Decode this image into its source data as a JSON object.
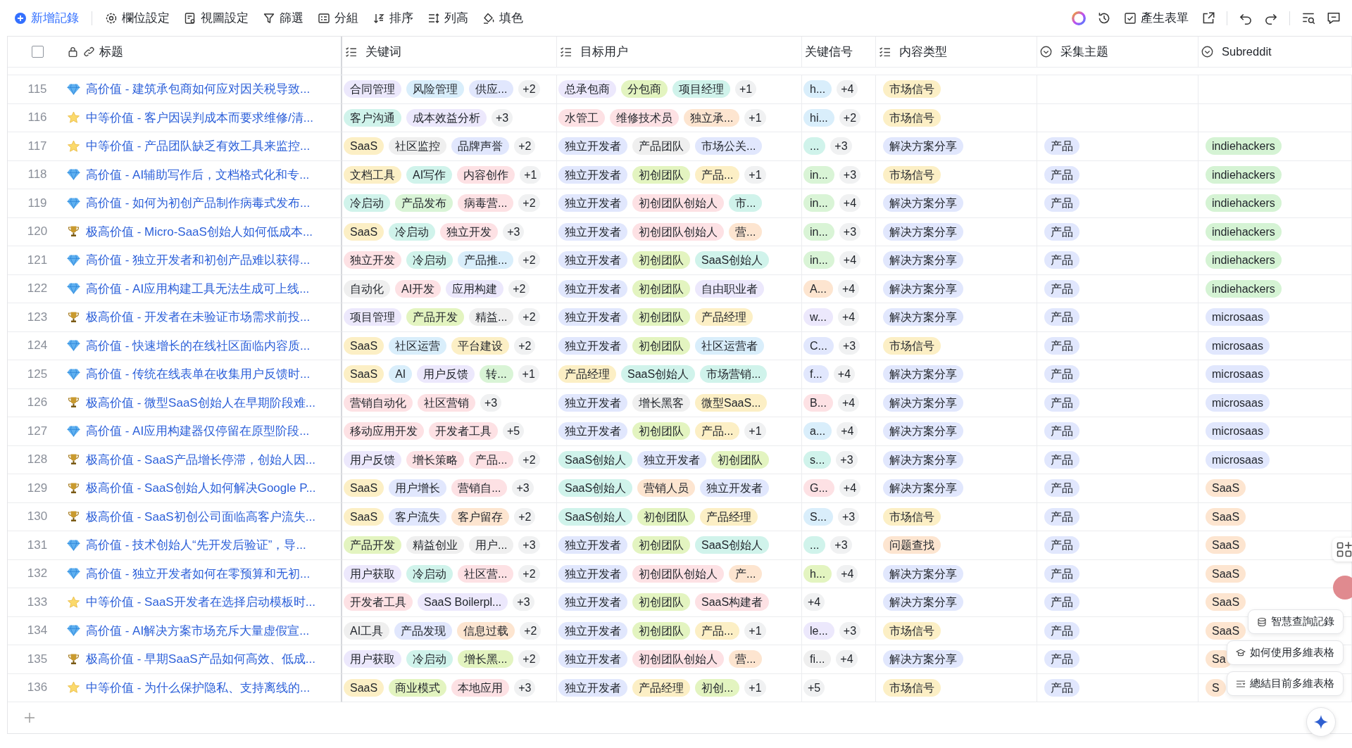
{
  "toolbar": {
    "actions": [
      "新增記錄",
      "欄位設定",
      "視圖設定",
      "篩選",
      "分組",
      "排序",
      "列高",
      "填色"
    ],
    "form_button": "產生表單"
  },
  "select_all": {
    "checked": false
  },
  "columns": [
    {
      "label": "标题"
    },
    {
      "label": "关键词"
    },
    {
      "label": "目标用户"
    },
    {
      "label": "关键信号"
    },
    {
      "label": "内容类型"
    },
    {
      "label": "采集主题"
    },
    {
      "label": "Subreddit"
    }
  ],
  "rows": [
    {
      "num": "115",
      "kind": "diamond",
      "title": "高价值 - 建筑承包商如何应对因关税导致...",
      "keywords": [
        {
          "text": "合同管理",
          "color": "#ece8fc"
        },
        {
          "text": "风险管理",
          "color": "#d9eefb"
        },
        {
          "text": "供应...",
          "color": "#e1e7fd"
        }
      ],
      "keywords_more": "+2",
      "users": [
        {
          "text": "总承包商",
          "color": "#ece8fc"
        },
        {
          "text": "分包商",
          "color": "#e3f4c0"
        },
        {
          "text": "项目经理",
          "color": "#d0f3eb"
        }
      ],
      "users_more": "+1",
      "signals": [
        {
          "text": "h...",
          "color": "#d9eefb"
        }
      ],
      "signals_more": "+4",
      "content_type": {
        "text": "市场信号",
        "color": "#fcefc5"
      }
    },
    {
      "num": "116",
      "kind": "star",
      "title": "中等价值 - 客户因误判成本而要求维修/清...",
      "keywords": [
        {
          "text": "客户沟通",
          "color": "#d0f3eb"
        },
        {
          "text": "成本效益分析",
          "color": "#ece8fc"
        }
      ],
      "keywords_more": "+3",
      "users": [
        {
          "text": "水管工",
          "color": "#fde1e4"
        },
        {
          "text": "维修技术员",
          "color": "#fde1e4"
        },
        {
          "text": "独立承...",
          "color": "#fde5d0"
        }
      ],
      "users_more": "+1",
      "signals": [
        {
          "text": "hi...",
          "color": "#d9eefb"
        }
      ],
      "signals_more": "+2",
      "content_type": {
        "text": "市场信号",
        "color": "#fcefc5"
      }
    },
    {
      "num": "117",
      "kind": "star",
      "title": "中等价值 - 产品团队缺乏有效工具来监控...",
      "keywords": [
        {
          "text": "SaaS",
          "color": "#fcefc5"
        },
        {
          "text": "社区监控",
          "color": "#efefef"
        },
        {
          "text": "品牌声誉",
          "color": "#e1e7fd"
        }
      ],
      "keywords_more": "+2",
      "users": [
        {
          "text": "独立开发者",
          "color": "#e1e7fd"
        },
        {
          "text": "产品团队",
          "color": "#efefef"
        },
        {
          "text": "市场公关...",
          "color": "#e1e7fd"
        }
      ],
      "signals": [
        {
          "text": "...",
          "color": "#d0f3eb"
        }
      ],
      "signals_more": "+3",
      "content_type": {
        "text": "解决方案分享",
        "color": "#e1e7fd"
      },
      "topic": {
        "text": "产品",
        "color": "#e1e7fd"
      },
      "subreddit": {
        "text": "indiehackers",
        "color": "#d5f3d4"
      }
    },
    {
      "num": "118",
      "kind": "diamond",
      "title": "高价值 - AI辅助写作后，文档格式化和专...",
      "keywords": [
        {
          "text": "文档工具",
          "color": "#fcefc5"
        },
        {
          "text": "AI写作",
          "color": "#d0f3eb"
        },
        {
          "text": "内容创作",
          "color": "#fde1e4"
        }
      ],
      "keywords_more": "+1",
      "users": [
        {
          "text": "独立开发者",
          "color": "#e1e7fd"
        },
        {
          "text": "初创团队",
          "color": "#e3f4c0"
        },
        {
          "text": "产品...",
          "color": "#fcefc5"
        }
      ],
      "users_more": "+1",
      "signals": [
        {
          "text": "in...",
          "color": "#d9f4d6"
        }
      ],
      "signals_more": "+3",
      "content_type": {
        "text": "市场信号",
        "color": "#fcefc5"
      },
      "topic": {
        "text": "产品",
        "color": "#e1e7fd"
      },
      "subreddit": {
        "text": "indiehackers",
        "color": "#d5f3d4"
      }
    },
    {
      "num": "119",
      "kind": "diamond",
      "title": "高价值 - 如何为初创产品制作病毒式发布...",
      "keywords": [
        {
          "text": "冷启动",
          "color": "#d0f3eb"
        },
        {
          "text": "产品发布",
          "color": "#d9f4d6"
        },
        {
          "text": "病毒营...",
          "color": "#fde1e4"
        }
      ],
      "keywords_more": "+2",
      "users": [
        {
          "text": "独立开发者",
          "color": "#e1e7fd"
        },
        {
          "text": "初创团队创始人",
          "color": "#fde1e4"
        },
        {
          "text": "市...",
          "color": "#d0f3eb"
        }
      ],
      "signals": [
        {
          "text": "in...",
          "color": "#d9f4d6"
        }
      ],
      "signals_more": "+4",
      "content_type": {
        "text": "解决方案分享",
        "color": "#e1e7fd"
      },
      "topic": {
        "text": "产品",
        "color": "#e1e7fd"
      },
      "subreddit": {
        "text": "indiehackers",
        "color": "#d5f3d4"
      }
    },
    {
      "num": "120",
      "kind": "trophy",
      "title": "极高价值 - Micro-SaaS创始人如何低成本...",
      "keywords": [
        {
          "text": "SaaS",
          "color": "#fcefc5"
        },
        {
          "text": "冷启动",
          "color": "#d0f3eb"
        },
        {
          "text": "独立开发",
          "color": "#fde1e4"
        }
      ],
      "keywords_more": "+3",
      "users": [
        {
          "text": "独立开发者",
          "color": "#e1e7fd"
        },
        {
          "text": "初创团队创始人",
          "color": "#fde1e4"
        },
        {
          "text": "营...",
          "color": "#fde5d0"
        }
      ],
      "signals": [
        {
          "text": "in...",
          "color": "#d9f4d6"
        }
      ],
      "signals_more": "+3",
      "content_type": {
        "text": "解决方案分享",
        "color": "#e1e7fd"
      },
      "topic": {
        "text": "产品",
        "color": "#e1e7fd"
      },
      "subreddit": {
        "text": "indiehackers",
        "color": "#d5f3d4"
      }
    },
    {
      "num": "121",
      "kind": "diamond",
      "title": "高价值 - 独立开发者和初创产品难以获得...",
      "keywords": [
        {
          "text": "独立开发",
          "color": "#fde1e4"
        },
        {
          "text": "冷启动",
          "color": "#d0f3eb"
        },
        {
          "text": "产品推...",
          "color": "#d9eefb"
        }
      ],
      "keywords_more": "+2",
      "users": [
        {
          "text": "独立开发者",
          "color": "#e1e7fd"
        },
        {
          "text": "初创团队",
          "color": "#e3f4c0"
        },
        {
          "text": "SaaS创始人",
          "color": "#d0f3eb"
        }
      ],
      "signals": [
        {
          "text": "in...",
          "color": "#d9f4d6"
        }
      ],
      "signals_more": "+4",
      "content_type": {
        "text": "解决方案分享",
        "color": "#e1e7fd"
      },
      "topic": {
        "text": "产品",
        "color": "#e1e7fd"
      },
      "subreddit": {
        "text": "indiehackers",
        "color": "#d5f3d4"
      }
    },
    {
      "num": "122",
      "kind": "diamond",
      "title": "高价值 - AI应用构建工具无法生成可上线...",
      "keywords": [
        {
          "text": "自动化",
          "color": "#efefef"
        },
        {
          "text": "AI开发",
          "color": "#fde1e4"
        },
        {
          "text": "应用构建",
          "color": "#ece8fc"
        }
      ],
      "keywords_more": "+2",
      "users": [
        {
          "text": "独立开发者",
          "color": "#e1e7fd"
        },
        {
          "text": "初创团队",
          "color": "#e3f4c0"
        },
        {
          "text": "自由职业者",
          "color": "#ece8fc"
        }
      ],
      "signals": [
        {
          "text": "A...",
          "color": "#fde5d0"
        }
      ],
      "signals_more": "+4",
      "content_type": {
        "text": "解决方案分享",
        "color": "#e1e7fd"
      },
      "topic": {
        "text": "产品",
        "color": "#e1e7fd"
      },
      "subreddit": {
        "text": "indiehackers",
        "color": "#d5f3d4"
      }
    },
    {
      "num": "123",
      "kind": "trophy",
      "title": "极高价值 - 开发者在未验证市场需求前投...",
      "keywords": [
        {
          "text": "项目管理",
          "color": "#ece8fc"
        },
        {
          "text": "产品开发",
          "color": "#e3f4c0"
        },
        {
          "text": "精益...",
          "color": "#efefef"
        }
      ],
      "keywords_more": "+2",
      "users": [
        {
          "text": "独立开发者",
          "color": "#e1e7fd"
        },
        {
          "text": "初创团队",
          "color": "#e3f4c0"
        },
        {
          "text": "产品经理",
          "color": "#fcefc5"
        }
      ],
      "signals": [
        {
          "text": "w...",
          "color": "#ece8fc"
        }
      ],
      "signals_more": "+4",
      "content_type": {
        "text": "解决方案分享",
        "color": "#e1e7fd"
      },
      "topic": {
        "text": "产品",
        "color": "#e1e7fd"
      },
      "subreddit": {
        "text": "microsaas",
        "color": "#e1e7fd"
      }
    },
    {
      "num": "124",
      "kind": "diamond",
      "title": "高价值 - 快速增长的在线社区面临内容质...",
      "keywords": [
        {
          "text": "SaaS",
          "color": "#fcefc5"
        },
        {
          "text": "社区运营",
          "color": "#d9eefb"
        },
        {
          "text": "平台建设",
          "color": "#fcefc5"
        }
      ],
      "keywords_more": "+2",
      "users": [
        {
          "text": "独立开发者",
          "color": "#e1e7fd"
        },
        {
          "text": "初创团队",
          "color": "#e3f4c0"
        },
        {
          "text": "社区运营者",
          "color": "#d9eefb"
        }
      ],
      "signals": [
        {
          "text": "C...",
          "color": "#e1e7fd"
        }
      ],
      "signals_more": "+3",
      "content_type": {
        "text": "市场信号",
        "color": "#fcefc5"
      },
      "topic": {
        "text": "产品",
        "color": "#e1e7fd"
      },
      "subreddit": {
        "text": "microsaas",
        "color": "#e1e7fd"
      }
    },
    {
      "num": "125",
      "kind": "diamond",
      "title": "高价值 - 传统在线表单在收集用户反馈时...",
      "keywords": [
        {
          "text": "SaaS",
          "color": "#fcefc5"
        },
        {
          "text": "AI",
          "color": "#d9eefb"
        },
        {
          "text": "用户反馈",
          "color": "#ece8fc"
        },
        {
          "text": "转...",
          "color": "#d9f4d6"
        }
      ],
      "keywords_more": "+1",
      "users": [
        {
          "text": "产品经理",
          "color": "#fcefc5"
        },
        {
          "text": "SaaS创始人",
          "color": "#d0f3eb"
        },
        {
          "text": "市场营销...",
          "color": "#d0f3eb"
        }
      ],
      "signals": [
        {
          "text": "f...",
          "color": "#e1e7fd"
        }
      ],
      "signals_more": "+4",
      "content_type": {
        "text": "解决方案分享",
        "color": "#e1e7fd"
      },
      "topic": {
        "text": "产品",
        "color": "#e1e7fd"
      },
      "subreddit": {
        "text": "microsaas",
        "color": "#e1e7fd"
      }
    },
    {
      "num": "126",
      "kind": "trophy",
      "title": "极高价值 - 微型SaaS创始人在早期阶段难...",
      "keywords": [
        {
          "text": "营销自动化",
          "color": "#fde1e4"
        },
        {
          "text": "社区营销",
          "color": "#fde1e4"
        }
      ],
      "keywords_more": "+3",
      "users": [
        {
          "text": "独立开发者",
          "color": "#e1e7fd"
        },
        {
          "text": "增长黑客",
          "color": "#efefef"
        },
        {
          "text": "微型SaaS...",
          "color": "#fcefc5"
        }
      ],
      "signals": [
        {
          "text": "B...",
          "color": "#fde1e4"
        }
      ],
      "signals_more": "+4",
      "content_type": {
        "text": "解决方案分享",
        "color": "#e1e7fd"
      },
      "topic": {
        "text": "产品",
        "color": "#e1e7fd"
      },
      "subreddit": {
        "text": "microsaas",
        "color": "#e1e7fd"
      }
    },
    {
      "num": "127",
      "kind": "diamond",
      "title": "高价值 - AI应用构建器仅停留在原型阶段...",
      "keywords": [
        {
          "text": "移动应用开发",
          "color": "#fde1e4"
        },
        {
          "text": "开发者工具",
          "color": "#fde1e4"
        }
      ],
      "keywords_more": "+5",
      "users": [
        {
          "text": "独立开发者",
          "color": "#e1e7fd"
        },
        {
          "text": "初创团队",
          "color": "#e3f4c0"
        },
        {
          "text": "产品...",
          "color": "#fcefc5"
        }
      ],
      "users_more": "+1",
      "signals": [
        {
          "text": "a...",
          "color": "#d9eefb"
        }
      ],
      "signals_more": "+4",
      "content_type": {
        "text": "解决方案分享",
        "color": "#e1e7fd"
      },
      "topic": {
        "text": "产品",
        "color": "#e1e7fd"
      },
      "subreddit": {
        "text": "microsaas",
        "color": "#e1e7fd"
      }
    },
    {
      "num": "128",
      "kind": "trophy",
      "title": "极高价值 - SaaS产品增长停滞，创始人因...",
      "keywords": [
        {
          "text": "用户反馈",
          "color": "#ece8fc"
        },
        {
          "text": "增长策略",
          "color": "#fde1e4"
        },
        {
          "text": "产品...",
          "color": "#fde1e4"
        }
      ],
      "keywords_more": "+2",
      "users": [
        {
          "text": "SaaS创始人",
          "color": "#d0f3eb"
        },
        {
          "text": "独立开发者",
          "color": "#e1e7fd"
        },
        {
          "text": "初创团队",
          "color": "#e3f4c0"
        }
      ],
      "signals": [
        {
          "text": "s...",
          "color": "#d0f3eb"
        }
      ],
      "signals_more": "+3",
      "content_type": {
        "text": "解决方案分享",
        "color": "#e1e7fd"
      },
      "topic": {
        "text": "产品",
        "color": "#e1e7fd"
      },
      "subreddit": {
        "text": "microsaas",
        "color": "#e1e7fd"
      }
    },
    {
      "num": "129",
      "kind": "trophy",
      "title": "极高价值 - SaaS创始人如何解决Google P...",
      "keywords": [
        {
          "text": "SaaS",
          "color": "#fcefc5"
        },
        {
          "text": "用户增长",
          "color": "#e1e7fd"
        },
        {
          "text": "营销自...",
          "color": "#fde1e4"
        }
      ],
      "keywords_more": "+3",
      "users": [
        {
          "text": "SaaS创始人",
          "color": "#d0f3eb"
        },
        {
          "text": "营销人员",
          "color": "#fde5d0"
        },
        {
          "text": "独立开发者",
          "color": "#e1e7fd"
        }
      ],
      "signals": [
        {
          "text": "G...",
          "color": "#fde1e4"
        }
      ],
      "signals_more": "+4",
      "content_type": {
        "text": "解决方案分享",
        "color": "#e1e7fd"
      },
      "topic": {
        "text": "产品",
        "color": "#e1e7fd"
      },
      "subreddit": {
        "text": "SaaS",
        "color": "#fde5d0"
      }
    },
    {
      "num": "130",
      "kind": "trophy",
      "title": "极高价值 - SaaS初创公司面临高客户流失...",
      "keywords": [
        {
          "text": "SaaS",
          "color": "#fcefc5"
        },
        {
          "text": "客户流失",
          "color": "#e1e7fd"
        },
        {
          "text": "客户留存",
          "color": "#fde5d0"
        }
      ],
      "keywords_more": "+2",
      "users": [
        {
          "text": "SaaS创始人",
          "color": "#d0f3eb"
        },
        {
          "text": "初创团队",
          "color": "#e3f4c0"
        },
        {
          "text": "产品经理",
          "color": "#fcefc5"
        }
      ],
      "signals": [
        {
          "text": "S...",
          "color": "#d9eefb"
        }
      ],
      "signals_more": "+3",
      "content_type": {
        "text": "市场信号",
        "color": "#fcefc5"
      },
      "topic": {
        "text": "产品",
        "color": "#e1e7fd"
      },
      "subreddit": {
        "text": "SaaS",
        "color": "#fde5d0"
      }
    },
    {
      "num": "131",
      "kind": "diamond",
      "title": "高价值 - 技术创始人“先开发后验证”，导...",
      "keywords": [
        {
          "text": "产品开发",
          "color": "#e3f4c0"
        },
        {
          "text": "精益创业",
          "color": "#efefef"
        },
        {
          "text": "用户...",
          "color": "#efefef"
        }
      ],
      "keywords_more": "+3",
      "users": [
        {
          "text": "独立开发者",
          "color": "#e1e7fd"
        },
        {
          "text": "初创团队",
          "color": "#e3f4c0"
        },
        {
          "text": "SaaS创始人",
          "color": "#d0f3eb"
        }
      ],
      "signals": [
        {
          "text": "...",
          "color": "#d0f3eb"
        }
      ],
      "signals_more": "+3",
      "content_type": {
        "text": "问题查找",
        "color": "#fde5d0"
      },
      "topic": {
        "text": "产品",
        "color": "#e1e7fd"
      },
      "subreddit": {
        "text": "SaaS",
        "color": "#fde5d0"
      }
    },
    {
      "num": "132",
      "kind": "diamond",
      "title": "高价值 - 独立开发者如何在零预算和无初...",
      "keywords": [
        {
          "text": "用户获取",
          "color": "#ece8fc"
        },
        {
          "text": "冷启动",
          "color": "#d0f3eb"
        },
        {
          "text": "社区营...",
          "color": "#fde1e4"
        }
      ],
      "keywords_more": "+2",
      "users": [
        {
          "text": "独立开发者",
          "color": "#e1e7fd"
        },
        {
          "text": "初创团队创始人",
          "color": "#fde1e4"
        },
        {
          "text": "产...",
          "color": "#fde5d0"
        }
      ],
      "signals": [
        {
          "text": "h...",
          "color": "#e3f4c0"
        }
      ],
      "signals_more": "+4",
      "content_type": {
        "text": "解决方案分享",
        "color": "#e1e7fd"
      },
      "topic": {
        "text": "产品",
        "color": "#e1e7fd"
      },
      "subreddit": {
        "text": "SaaS",
        "color": "#fde5d0"
      }
    },
    {
      "num": "133",
      "kind": "star",
      "title": "中等价值 - SaaS开发者在选择启动模板时...",
      "keywords": [
        {
          "text": "开发者工具",
          "color": "#fde1e4"
        },
        {
          "text": "SaaS Boilerpl...",
          "color": "#ece8fc"
        }
      ],
      "keywords_more": "+3",
      "users": [
        {
          "text": "独立开发者",
          "color": "#e1e7fd"
        },
        {
          "text": "初创团队",
          "color": "#e3f4c0"
        },
        {
          "text": "SaaS构建者",
          "color": "#fde1e4"
        }
      ],
      "signals": [],
      "signals_more": "+4",
      "content_type": {
        "text": "解决方案分享",
        "color": "#e1e7fd"
      },
      "topic": {
        "text": "产品",
        "color": "#e1e7fd"
      },
      "subreddit": {
        "text": "SaaS",
        "color": "#fde5d0"
      }
    },
    {
      "num": "134",
      "kind": "diamond",
      "title": "高价值 - AI解决方案市场充斥大量虚假宣...",
      "keywords": [
        {
          "text": "AI工具",
          "color": "#efefef"
        },
        {
          "text": "产品发现",
          "color": "#e1e7fd"
        },
        {
          "text": "信息过载",
          "color": "#fde5d0"
        }
      ],
      "keywords_more": "+2",
      "users": [
        {
          "text": "独立开发者",
          "color": "#e1e7fd"
        },
        {
          "text": "初创团队",
          "color": "#e3f4c0"
        },
        {
          "text": "产品...",
          "color": "#fcefc5"
        }
      ],
      "users_more": "+1",
      "signals": [
        {
          "text": "le...",
          "color": "#ece8fc"
        }
      ],
      "signals_more": "+3",
      "content_type": {
        "text": "市场信号",
        "color": "#fcefc5"
      },
      "topic": {
        "text": "产品",
        "color": "#e1e7fd"
      },
      "subreddit": {
        "text": "SaaS",
        "color": "#fde5d0"
      }
    },
    {
      "num": "135",
      "kind": "trophy",
      "title": "极高价值 - 早期SaaS产品如何高效、低成...",
      "keywords": [
        {
          "text": "用户获取",
          "color": "#ece8fc"
        },
        {
          "text": "冷启动",
          "color": "#d0f3eb"
        },
        {
          "text": "增长黑...",
          "color": "#e3f4c0"
        }
      ],
      "keywords_more": "+2",
      "users": [
        {
          "text": "独立开发者",
          "color": "#e1e7fd"
        },
        {
          "text": "初创团队创始人",
          "color": "#fde1e4"
        },
        {
          "text": "营...",
          "color": "#fde5d0"
        }
      ],
      "signals": [
        {
          "text": "fi...",
          "color": "#efefef"
        }
      ],
      "signals_more": "+4",
      "content_type": {
        "text": "解决方案分享",
        "color": "#e1e7fd"
      },
      "topic": {
        "text": "产品",
        "color": "#e1e7fd"
      },
      "subreddit": {
        "text": "Sa",
        "color": "#fde5d0"
      }
    },
    {
      "num": "136",
      "kind": "star",
      "title": "中等价值 - 为什么保护隐私、支持离线的...",
      "keywords": [
        {
          "text": "SaaS",
          "color": "#fcefc5"
        },
        {
          "text": "商业模式",
          "color": "#e3f4c0"
        },
        {
          "text": "本地应用",
          "color": "#fde1e4"
        }
      ],
      "keywords_more": "+3",
      "users": [
        {
          "text": "独立开发者",
          "color": "#e1e7fd"
        },
        {
          "text": "产品经理",
          "color": "#fcefc5"
        },
        {
          "text": "初创...",
          "color": "#e3f4c0"
        }
      ],
      "users_more": "+1",
      "signals": [],
      "signals_more": "+5",
      "content_type": {
        "text": "市场信号",
        "color": "#fcefc5"
      },
      "topic": {
        "text": "产品",
        "color": "#e1e7fd"
      },
      "subreddit": {
        "text": "S",
        "color": "#fde5d0"
      }
    }
  ],
  "assistant_menu": [
    "智慧查詢記錄",
    "如何使用多維表格",
    "總結目前多維表格"
  ]
}
